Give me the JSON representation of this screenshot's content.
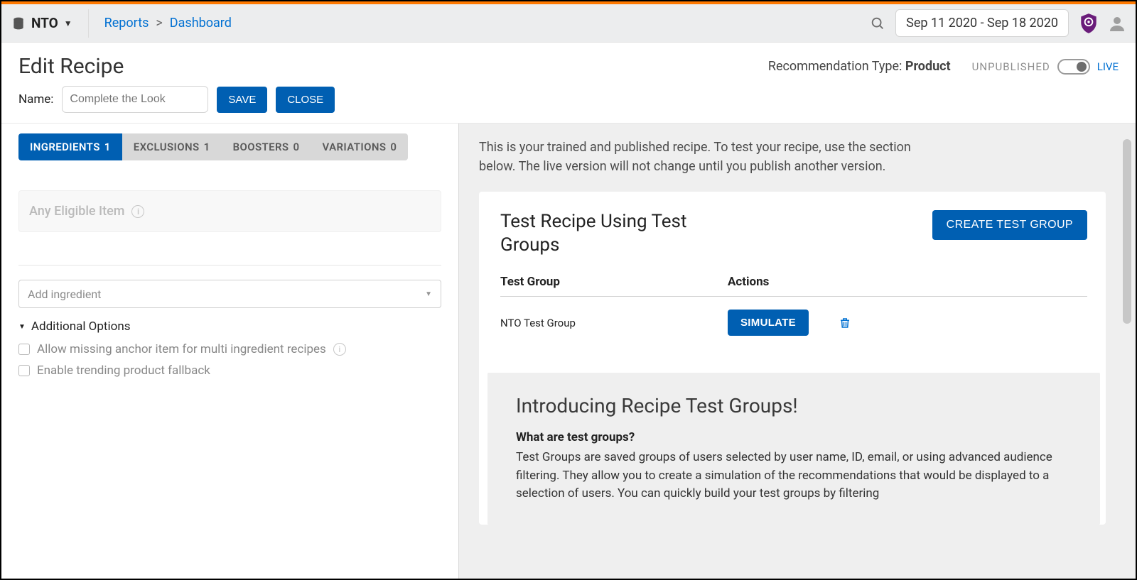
{
  "topbar": {
    "org": "NTO",
    "breadcrumbs": {
      "reports": "Reports",
      "sep": ">",
      "dashboard": "Dashboard"
    },
    "date_range": "Sep 11 2020 - Sep 18 2020"
  },
  "header": {
    "title": "Edit Recipe",
    "rectype_label": "Recommendation Type:",
    "rectype_value": "Product",
    "pub": {
      "unpub": "UNPUBLISHED",
      "live": "LIVE"
    },
    "name_label": "Name:",
    "name_placeholder": "Complete the Look",
    "save": "SAVE",
    "close": "CLOSE"
  },
  "tabs": {
    "ingredients": {
      "label": "INGREDIENTS",
      "count": "1"
    },
    "exclusions": {
      "label": "EXCLUSIONS",
      "count": "1"
    },
    "boosters": {
      "label": "BOOSTERS",
      "count": "0"
    },
    "variations": {
      "label": "VARIATIONS",
      "count": "0"
    }
  },
  "left": {
    "eligible": "Any Eligible Item",
    "add_ingredient_placeholder": "Add ingredient",
    "additional_options": "Additional Options",
    "opt_missing_anchor": "Allow missing anchor item for multi ingredient recipes",
    "opt_trending_fallback": "Enable trending product fallback"
  },
  "right": {
    "trained_text": "This is your trained and published recipe. To test your recipe, use the section below. The live version will not change until you publish another version.",
    "card_title": "Test Recipe Using Test Groups",
    "create_btn": "CREATE TEST GROUP",
    "col_testgroup": "Test Group",
    "col_actions": "Actions",
    "row1_name": "NTO Test Group",
    "simulate": "SIMULATE",
    "intro_title": "Introducing Recipe Test Groups!",
    "intro_sub": "What are test groups?",
    "intro_body": "Test Groups are saved groups of users selected by user name, ID, email, or using advanced audience filtering. They allow you to create a simulation of the recommendations that would be displayed to a selection of users. You can quickly build your test groups by filtering"
  }
}
